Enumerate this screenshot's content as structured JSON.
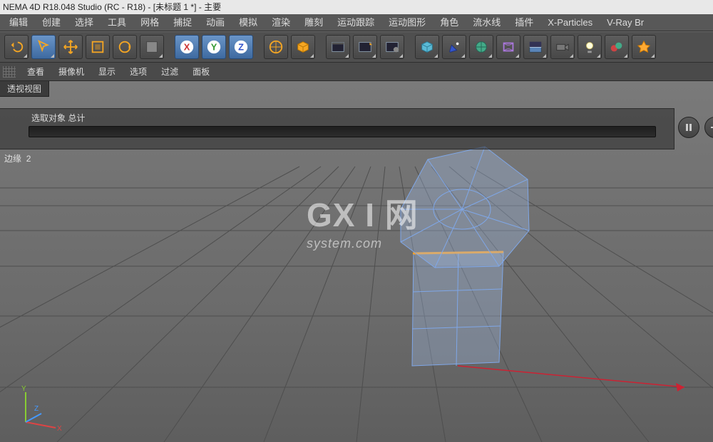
{
  "window": {
    "title": "NEMA 4D R18.048 Studio (RC - R18) - [未标题 1 *] - 主要"
  },
  "menu": {
    "items": [
      "编辑",
      "创建",
      "选择",
      "工具",
      "网格",
      "捕捉",
      "动画",
      "模拟",
      "渲染",
      "雕刻",
      "运动跟踪",
      "运动图形",
      "角色",
      "流水线",
      "插件",
      "X-Particles",
      "V-Ray Br"
    ]
  },
  "toolbar_icons": [
    "undo",
    "live-select",
    "move",
    "scale",
    "rotate",
    "recent",
    "axis-x",
    "axis-y",
    "axis-z",
    "coord",
    "render-pv",
    "render-region",
    "render-settings",
    "cube",
    "pen",
    "subdiv",
    "deformer",
    "environment",
    "camera",
    "light",
    "scene",
    "materials"
  ],
  "viewbar": {
    "items": [
      "查看",
      "摄像机",
      "显示",
      "选项",
      "过滤",
      "面板"
    ]
  },
  "viewport": {
    "tab": "透视视图",
    "hud_label": "选取对象  总计",
    "edge_label": "边缘",
    "edge_count": "2"
  },
  "watermark": {
    "line1": "GX I 网",
    "line2": "system.com"
  },
  "axis_labels": {
    "x": "X",
    "y": "Y",
    "z": "Z"
  },
  "colors": {
    "axis_x": "#d33",
    "axis_y": "#6c3",
    "axis_z": "#39f",
    "select_edge": "#f7a12b",
    "wire": "#7fa7e8",
    "face": "rgba(160,185,225,0.35)"
  }
}
